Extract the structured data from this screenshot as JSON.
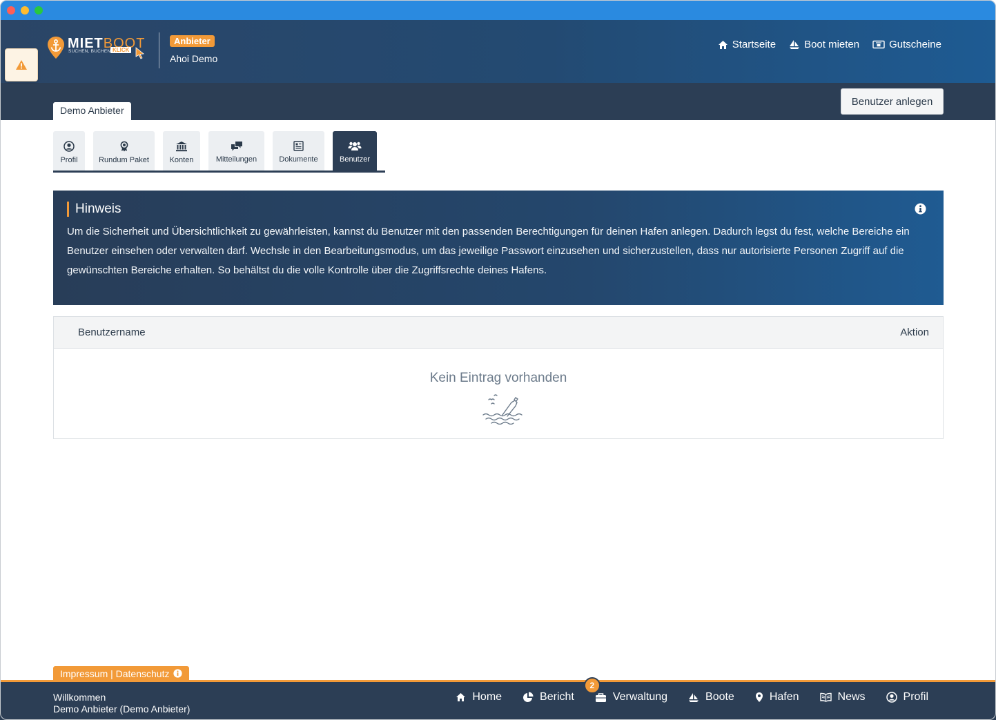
{
  "brand": {
    "logo_main": "MIET",
    "logo_accent": "BOOT",
    "logo_tagline": "SUCHEN, BUCHEN",
    "logo_klick": "KLICK"
  },
  "header": {
    "role_badge": "Anbieter",
    "company": "Ahoi Demo",
    "nav": [
      {
        "label": "Startseite",
        "icon": "home-icon"
      },
      {
        "label": "Boot mieten",
        "icon": "sailboat-icon"
      },
      {
        "label": "Gutscheine",
        "icon": "voucher-icon"
      }
    ]
  },
  "subheader": {
    "provider_tab": "Demo Anbieter",
    "create_button": "Benutzer anlegen"
  },
  "tabs": [
    {
      "label": "Profil",
      "icon": "user-circle-icon",
      "active": false
    },
    {
      "label": "Rundum Paket",
      "icon": "award-icon",
      "active": false
    },
    {
      "label": "Konten",
      "icon": "bank-icon",
      "active": false
    },
    {
      "label": "Mitteilungen",
      "icon": "comments-icon",
      "active": false
    },
    {
      "label": "Dokumente",
      "icon": "document-icon",
      "active": false
    },
    {
      "label": "Benutzer",
      "icon": "users-icon",
      "active": true
    }
  ],
  "notice": {
    "title": "Hinweis",
    "text": "Um die Sicherheit und Übersichtlichkeit zu gewährleisten, kannst du Benutzer mit den passenden Berechtigungen für deinen Hafen anlegen. Dadurch legst du fest, welche Bereiche ein Benutzer einsehen oder verwalten darf. Wechsle in den Bearbeitungsmodus, um das jeweilige Passwort einzusehen und sicherzustellen, dass nur autorisierte Personen Zugriff auf die gewünschten Bereiche erhalten. So behältst du die volle Kontrolle über die Zugriffsrechte deines Hafens."
  },
  "table": {
    "col_user": "Benutzername",
    "col_action": "Aktion",
    "empty": "Kein Eintrag vorhanden"
  },
  "footer": {
    "impressum": "Impressum | Datenschutz",
    "welcome_line1": "Willkommen",
    "welcome_line2": "Demo Anbieter (Demo Anbieter)",
    "nav": [
      {
        "label": "Home",
        "icon": "home-icon"
      },
      {
        "label": "Bericht",
        "icon": "pie-chart-icon"
      },
      {
        "label": "Verwaltung",
        "icon": "briefcase-icon",
        "badge": "2"
      },
      {
        "label": "Boote",
        "icon": "sailboat-icon"
      },
      {
        "label": "Hafen",
        "icon": "map-pin-icon"
      },
      {
        "label": "News",
        "icon": "book-icon"
      },
      {
        "label": "Profil",
        "icon": "user-circle-icon"
      }
    ]
  },
  "colors": {
    "accent": "#f29a38",
    "navy": "#2c3e55",
    "titlebar": "#2a8ae0"
  }
}
